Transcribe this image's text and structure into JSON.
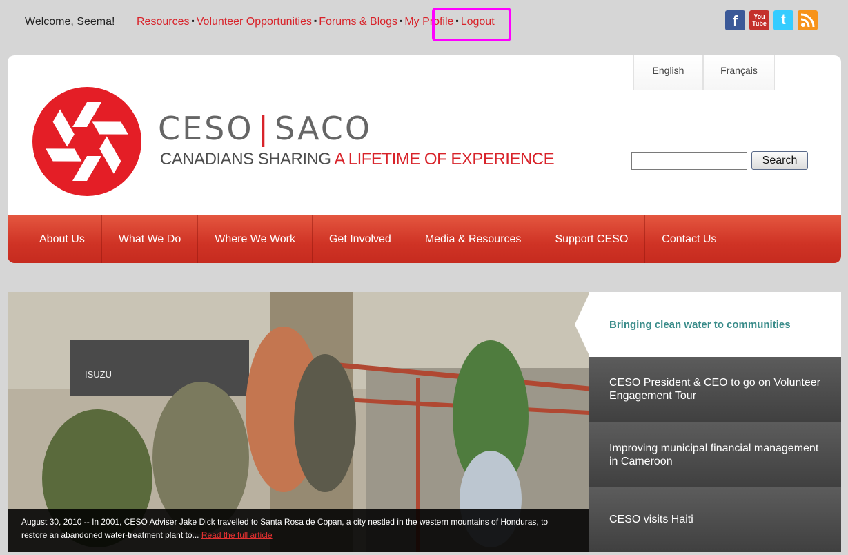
{
  "topbar": {
    "welcome": "Welcome, Seema!",
    "links": [
      "Resources",
      "Volunteer Opportunities",
      "Forums & Blogs",
      "My Profile",
      "Logout"
    ],
    "social": [
      "facebook-icon",
      "youtube-icon",
      "twitter-icon",
      "rss-icon"
    ],
    "youtube_text": "You Tube"
  },
  "header": {
    "languages": [
      "English",
      "Français"
    ],
    "logo_left": "CESO",
    "logo_right": "SACO",
    "tagline_gray": "CANADIANS SHARING ",
    "tagline_red": "A LIFETIME OF EXPERIENCE",
    "search_value": "",
    "search_button": "Search"
  },
  "nav": [
    "About Us",
    "What We Do",
    "Where We Work",
    "Get Involved",
    "Media & Resources",
    "Support CESO",
    "Contact Us"
  ],
  "feature": {
    "caption": "August 30, 2010 -- In 2001, CESO Adviser Jake Dick travelled to Santa Rosa de Copan, a city nestled in the western mountains of Honduras, to restore an abandoned water-treatment plant to... ",
    "read_more": "Read the full article",
    "truck_label": "ISUZU",
    "stories": [
      "Bringing clean water to communities",
      "CESO President & CEO to go on Volunteer Engagement Tour",
      "Improving municipal financial management in Cameroon",
      "CESO visits Haiti"
    ]
  },
  "colors": {
    "brand_red": "#d8232a",
    "highlight": "#ff00ff",
    "active_story": "#3a8c8a"
  }
}
